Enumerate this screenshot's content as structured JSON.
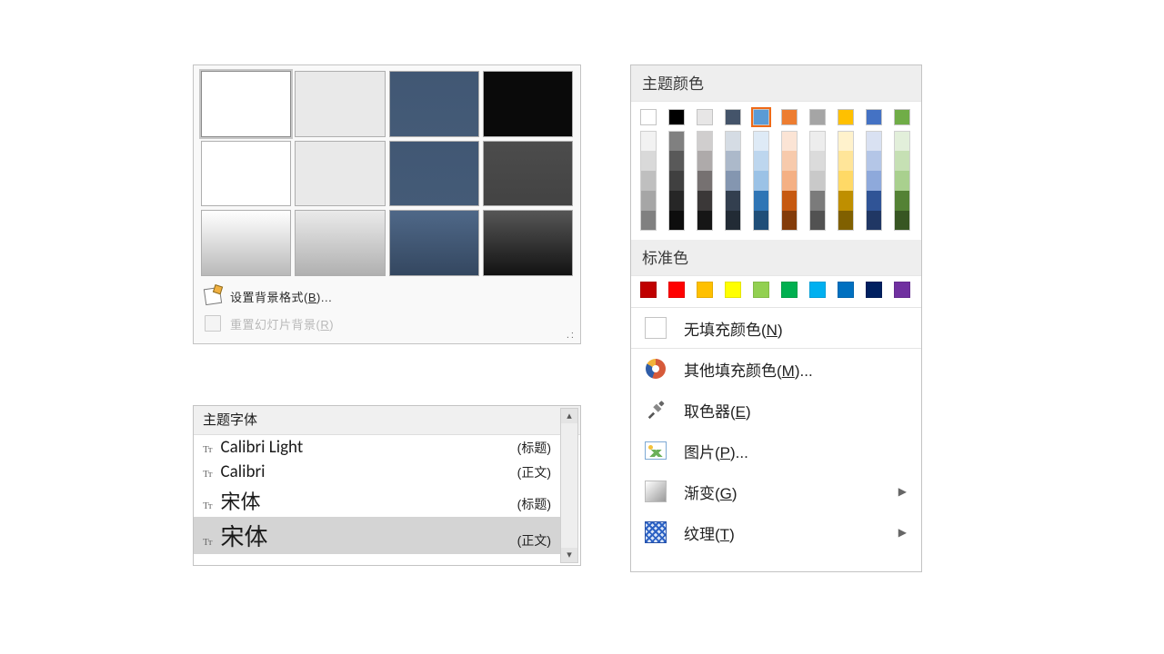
{
  "backgroundGallery": {
    "cells": [
      {
        "name": "bg-thumb-white",
        "cls": "grad-white",
        "selected": true
      },
      {
        "name": "bg-thumb-lightgray",
        "cls": "grad-lightgray",
        "selected": false
      },
      {
        "name": "bg-thumb-darkblue",
        "cls": "grad-blue",
        "selected": false
      },
      {
        "name": "bg-thumb-black",
        "cls": "grad-black",
        "selected": false
      },
      {
        "name": "bg-thumb-white-2",
        "cls": "grad-white",
        "selected": false
      },
      {
        "name": "bg-thumb-lightgray-2",
        "cls": "grad-lightgray",
        "selected": false
      },
      {
        "name": "bg-thumb-darkblue-2",
        "cls": "grad-blue",
        "selected": false
      },
      {
        "name": "bg-thumb-darkgray",
        "cls": "grad-dkgray",
        "selected": false
      },
      {
        "name": "bg-thumb-white-grad",
        "cls": "grad-lite-fade",
        "selected": false
      },
      {
        "name": "bg-thumb-gray-grad",
        "cls": "grad-gray-fade",
        "selected": false
      },
      {
        "name": "bg-thumb-blue-grad",
        "cls": "grad-blue-fade",
        "selected": false
      },
      {
        "name": "bg-thumb-black-grad",
        "cls": "grad-dk-fade",
        "selected": false
      }
    ],
    "menu": {
      "formatBackground": {
        "pre": "设置背景格式(",
        "accel": "B",
        "post": ")...",
        "enabled": true
      },
      "resetBackground": {
        "pre": "重置幻灯片背景(",
        "accel": "R",
        "post": ")",
        "enabled": false
      }
    }
  },
  "fontPanel": {
    "header": "主题字体",
    "items": [
      {
        "name": "font-item-calibri-light",
        "font": "Calibri Light",
        "role": "(标题)",
        "latin": true,
        "selected": false,
        "size": "sm"
      },
      {
        "name": "font-item-calibri",
        "font": "Calibri",
        "role": "(正文)",
        "latin": true,
        "selected": false,
        "size": "sm"
      },
      {
        "name": "font-item-songti-title",
        "font": "宋体",
        "role": "(标题)",
        "latin": false,
        "selected": false,
        "size": "sm"
      },
      {
        "name": "font-item-songti-body",
        "font": "宋体",
        "role": "(正文)",
        "latin": false,
        "selected": true,
        "size": "lg"
      }
    ]
  },
  "colorPanel": {
    "themeTitle": "主题颜色",
    "themeRow": [
      {
        "c": "#ffffff"
      },
      {
        "c": "#000000"
      },
      {
        "c": "#e7e6e6"
      },
      {
        "c": "#44546a"
      },
      {
        "c": "#5b9bd5",
        "selected": true
      },
      {
        "c": "#ed7d31"
      },
      {
        "c": "#a5a5a5"
      },
      {
        "c": "#ffc000"
      },
      {
        "c": "#4472c4"
      },
      {
        "c": "#70ad47"
      }
    ],
    "tintCols": [
      [
        "#f2f2f2",
        "#d9d9d9",
        "#bfbfbf",
        "#a6a6a6",
        "#808080"
      ],
      [
        "#808080",
        "#595959",
        "#404040",
        "#262626",
        "#0d0d0d"
      ],
      [
        "#d0cece",
        "#aeaaaa",
        "#767171",
        "#3b3838",
        "#161616"
      ],
      [
        "#d5dce4",
        "#acb9ca",
        "#8496b0",
        "#333f4f",
        "#222b35"
      ],
      [
        "#deeaf6",
        "#bdd6ee",
        "#9bc2e6",
        "#2f75b5",
        "#1f4e78"
      ],
      [
        "#fbe4d5",
        "#f7caac",
        "#f4b084",
        "#c65911",
        "#833c0b"
      ],
      [
        "#ededed",
        "#dbdbdb",
        "#c9c9c9",
        "#7b7b7b",
        "#525252"
      ],
      [
        "#fff2cc",
        "#ffe599",
        "#ffd966",
        "#bf8f00",
        "#806000"
      ],
      [
        "#d9e1f2",
        "#b4c6e7",
        "#8ea9db",
        "#305496",
        "#203764"
      ],
      [
        "#e2efda",
        "#c6e0b4",
        "#a9d08e",
        "#548235",
        "#375623"
      ]
    ],
    "standardTitle": "标准色",
    "standardRow": [
      "#c00000",
      "#ff0000",
      "#ffc000",
      "#ffff00",
      "#92d050",
      "#00b050",
      "#00b0f0",
      "#0070c0",
      "#002060",
      "#7030a0"
    ],
    "menu": {
      "noFill": {
        "pre": "无填充颜色(",
        "accel": "N",
        "post": ")"
      },
      "moreFill": {
        "pre": "其他填充颜色(",
        "accel": "M",
        "post": ")..."
      },
      "eyedrop": {
        "pre": "取色器(",
        "accel": "E",
        "post": ")"
      },
      "picture": {
        "pre": "图片(",
        "accel": "P",
        "post": ")..."
      },
      "gradient": {
        "pre": "渐变(",
        "accel": "G",
        "post": ")"
      },
      "texture": {
        "pre": "纹理(",
        "accel": "T",
        "post": ")"
      }
    }
  }
}
